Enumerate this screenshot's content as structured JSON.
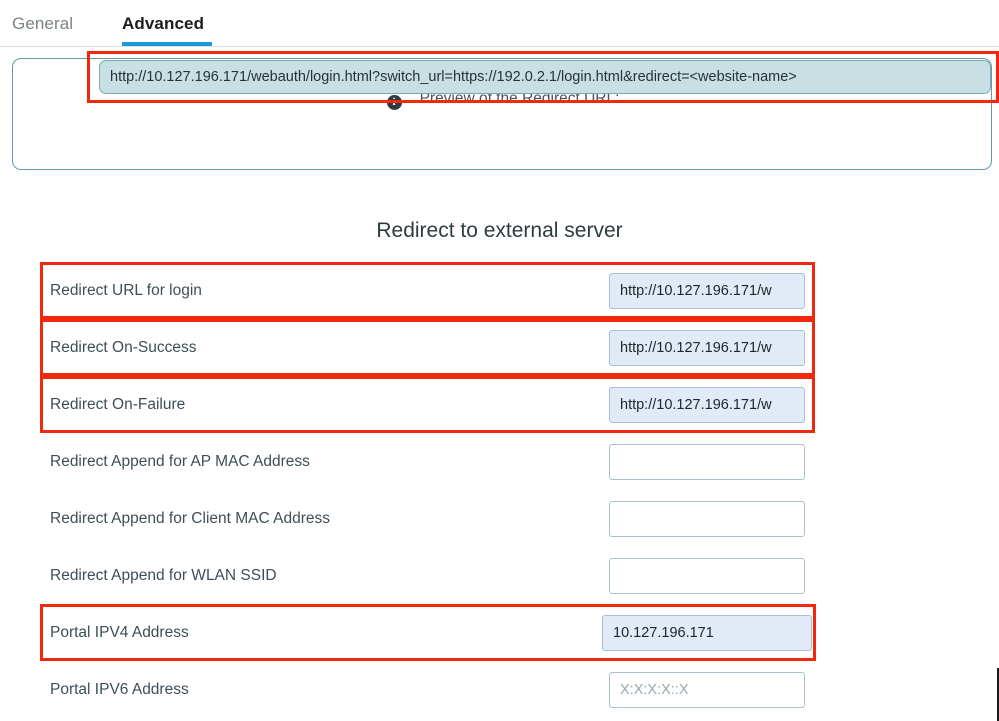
{
  "tabs": [
    {
      "label": "General",
      "active": false
    },
    {
      "label": "Advanced",
      "active": true
    }
  ],
  "preview": {
    "info_icon": "info-icon",
    "heading": "Preview of the Redirect URL:",
    "url": "http://10.127.196.171/webauth/login.html?switch_url=https://192.0.2.1/login.html&redirect=<website-name>",
    "border_color": "#5f9ea4",
    "field_background": "#c8e0e3",
    "highlight_color": "#f0280d"
  },
  "section": {
    "title": "Redirect to external server"
  },
  "form": {
    "rows": [
      {
        "label": "Redirect URL for login",
        "value": "http://10.127.196.171/w",
        "placeholder": "",
        "filled": true,
        "highlighted": true
      },
      {
        "label": "Redirect On-Success",
        "value": "http://10.127.196.171/w",
        "placeholder": "",
        "filled": true,
        "highlighted": true
      },
      {
        "label": "Redirect On-Failure",
        "value": "http://10.127.196.171/w",
        "placeholder": "",
        "filled": true,
        "highlighted": true
      },
      {
        "label": "Redirect Append for AP MAC Address",
        "value": "",
        "placeholder": "",
        "filled": false,
        "highlighted": false
      },
      {
        "label": "Redirect Append for Client MAC Address",
        "value": "",
        "placeholder": "",
        "filled": false,
        "highlighted": false
      },
      {
        "label": "Redirect Append for WLAN SSID",
        "value": "",
        "placeholder": "",
        "filled": false,
        "highlighted": false
      },
      {
        "label": "Portal IPV4 Address",
        "value": "10.127.196.171",
        "placeholder": "",
        "filled": true,
        "highlighted": true,
        "wide": true
      },
      {
        "label": "Portal IPV6 Address",
        "value": "",
        "placeholder": "X:X:X:X::X",
        "filled": false,
        "highlighted": false
      }
    ]
  },
  "theme": {
    "active_tab_underline": "#1a9ad7",
    "highlight_red": "#f0280d",
    "filled_input_bg": "#e1ebf7",
    "input_border": "#a9c0cd"
  }
}
